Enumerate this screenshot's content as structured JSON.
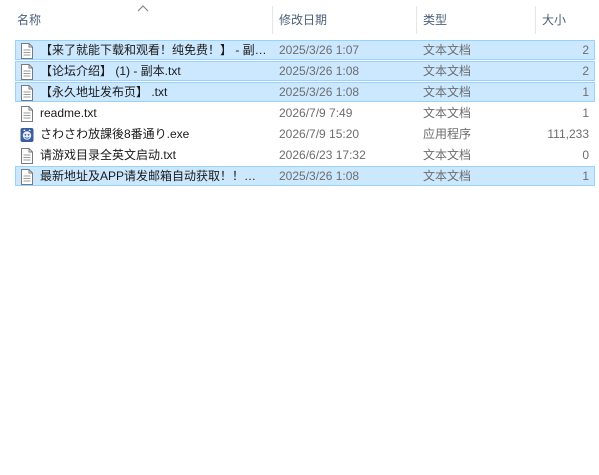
{
  "columns": {
    "name": "名称",
    "date": "修改日期",
    "type": "类型",
    "size": "大小"
  },
  "files": [
    {
      "name": "【来了就能下载和观看！纯免费！】 - 副本.txt",
      "date": "2025/3/26 1:07",
      "type": "文本文档",
      "size": "2",
      "icon": "text-file-icon",
      "selected": true
    },
    {
      "name": "【论坛介绍】 (1) - 副本.txt",
      "date": "2025/3/26 1:08",
      "type": "文本文档",
      "size": "2",
      "icon": "text-file-icon",
      "selected": true
    },
    {
      "name": "【永久地址发布页】 .txt",
      "date": "2025/3/26 1:08",
      "type": "文本文档",
      "size": "1",
      "icon": "text-file-icon",
      "selected": true
    },
    {
      "name": "readme.txt",
      "date": "2026/7/9 7:49",
      "type": "文本文档",
      "size": "1",
      "icon": "text-file-icon",
      "selected": false
    },
    {
      "name": "さわさわ放課後8番通り.exe",
      "date": "2026/7/9 15:20",
      "type": "应用程序",
      "size": "111,233",
      "icon": "application-icon",
      "selected": false
    },
    {
      "name": "请游戏目录全英文启动.txt",
      "date": "2026/6/23 17:32",
      "type": "文本文档",
      "size": "0",
      "icon": "text-file-icon",
      "selected": false
    },
    {
      "name": "最新地址及APP请发邮箱自动获取！！！.txt",
      "date": "2025/3/26 1:08",
      "type": "文本文档",
      "size": "1",
      "icon": "text-file-icon",
      "selected": true
    }
  ],
  "colors": {
    "selection_fill": "#cce8ff",
    "selection_border": "#99d1ff",
    "header_text": "#4c607a"
  }
}
